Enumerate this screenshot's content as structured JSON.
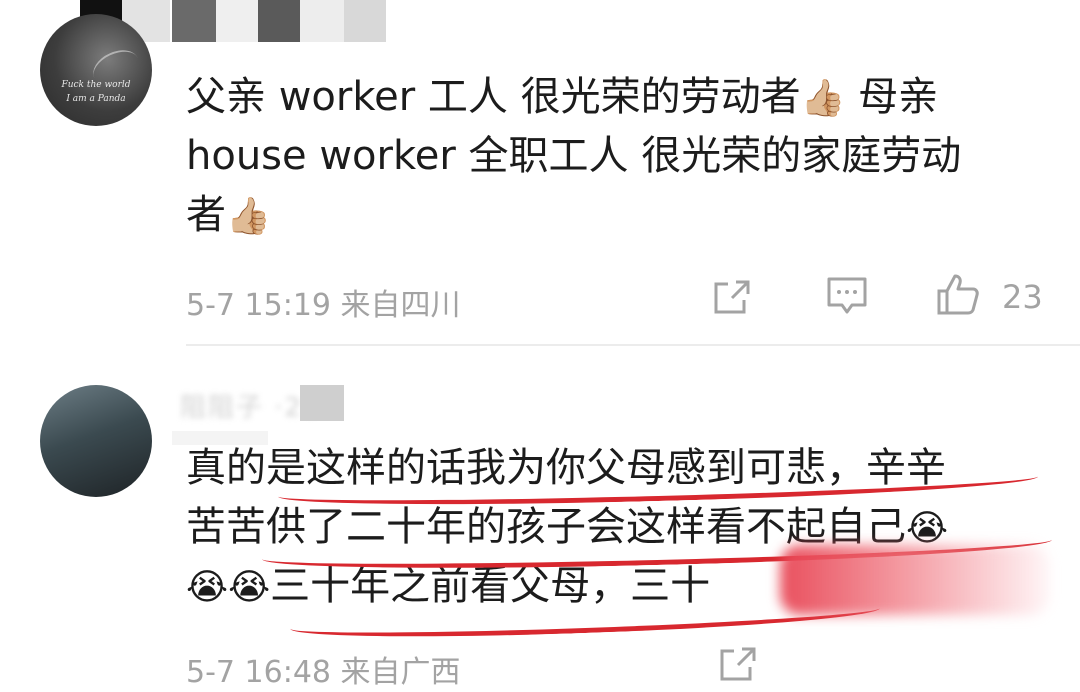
{
  "comments": [
    {
      "avatar_text": [
        "Fuck the world",
        "I am a Panda"
      ],
      "text_before_emoji1": "父亲 worker 工人 很光荣的劳动者",
      "emoji1": "👍🏼",
      "text_mid": " 母亲\nhouse worker 全职工人 很光荣的家庭劳动\n者",
      "emoji2": "👍🏼",
      "date": "5-7 15:19",
      "location": "来自四川",
      "like_count": "23",
      "icons": [
        "share-icon",
        "comment-icon",
        "like-icon"
      ]
    },
    {
      "name_obscured": "阻阻子 ·28",
      "text_line1": "真的是这样的话我为你父母感到可悲，辛辛",
      "text_line2": "苦苦供了二十年的孩子会这样看不起自己",
      "emoji_end": "😭",
      "emoji_start": "😭😭",
      "text_line3": "三十年之前看父母，三十",
      "date": "5-7 16:48",
      "location": "来自广西",
      "icons": [
        "share-icon"
      ]
    }
  ],
  "colors": {
    "text": "#1c1c1c",
    "meta": "#a3a3a3",
    "underline": "#d8282f",
    "divider": "#ececec"
  }
}
